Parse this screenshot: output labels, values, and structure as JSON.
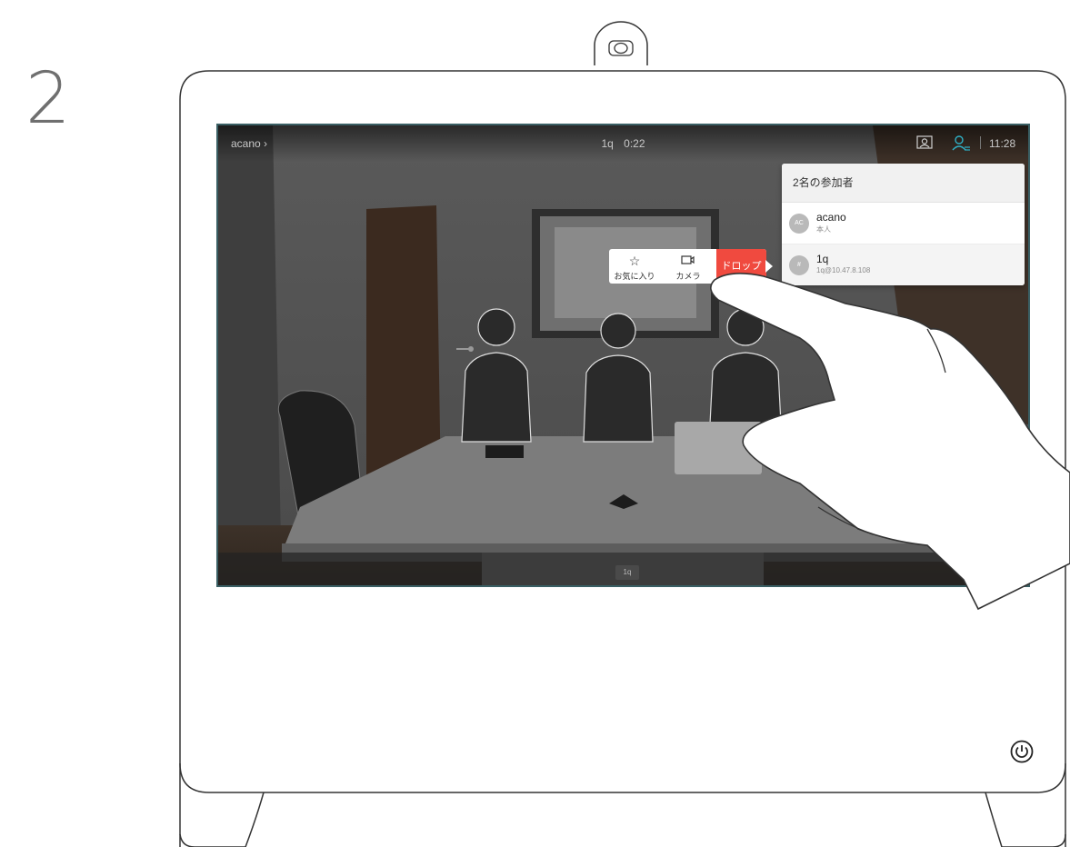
{
  "step": {
    "number": "2"
  },
  "topbar": {
    "breadcrumb": "acano",
    "call_name": "1q",
    "call_duration": "0:22",
    "clock": "11:28",
    "icons": [
      "selfview-icon",
      "participants-icon"
    ]
  },
  "panel": {
    "title": "2名の参加者",
    "participants": [
      {
        "initials": "AC",
        "name": "acano",
        "subtitle": "本人"
      },
      {
        "initials": "#",
        "name": "1q",
        "subtitle": "1q@10.47.8.108"
      }
    ]
  },
  "actions": {
    "favorite_label": "お気に入り",
    "favorite_icon": "star-icon",
    "camera_label": "カメラ",
    "camera_icon": "camera-icon",
    "drop_label": "ドロップ",
    "drop_color": "#f04a3f"
  },
  "video": {
    "center_tag": "1q"
  },
  "colors": {
    "accent": "#2fb0c6",
    "drop": "#f04a3f"
  }
}
